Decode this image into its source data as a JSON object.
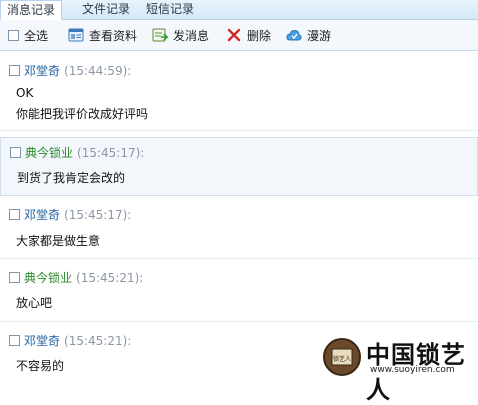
{
  "tabs": [
    {
      "label": "消息记录",
      "active": true
    },
    {
      "label": "文件记录",
      "active": false
    },
    {
      "label": "短信记录",
      "active": false
    }
  ],
  "toolbar": {
    "select_all": "全选",
    "view_profile": "查看资料",
    "send_message": "发消息",
    "delete": "删除",
    "roam": "漫游"
  },
  "messages": [
    {
      "sender": "邓堂奇",
      "time": "(15:44:59):",
      "lines": [
        "OK",
        "你能把我评价改成好评吗"
      ],
      "color": "#1f5f9e"
    },
    {
      "sender": "典今锁业",
      "time": "(15:45:17):",
      "lines": [
        "到货了我肯定会改的"
      ],
      "color": "#2a8a2a"
    },
    {
      "sender": "邓堂奇",
      "time": "(15:45:17):",
      "lines": [
        "大家都是做生意"
      ],
      "color": "#1f5f9e"
    },
    {
      "sender": "典今锁业",
      "time": "(15:45:21):",
      "lines": [
        "放心吧"
      ],
      "color": "#2a8a2a"
    },
    {
      "sender": "邓堂奇",
      "time": "(15:45:21):",
      "lines": [
        "不容易的"
      ],
      "color": "#1f5f9e"
    }
  ],
  "watermark": {
    "title": "中国锁艺人",
    "url": "www.suoyiren.com",
    "seal_text": "锁艺人"
  },
  "colors": {
    "accent": "#1f5f9e",
    "green": "#2a8a2a",
    "tabbar": "#d6e8f6"
  }
}
